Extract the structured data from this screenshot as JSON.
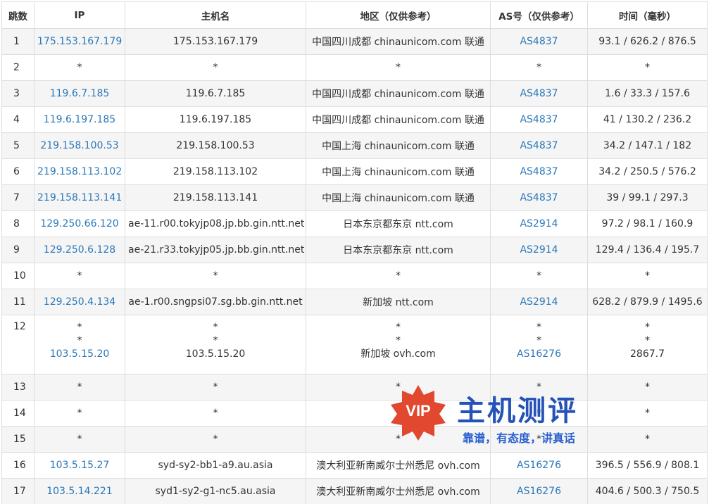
{
  "headers": [
    "跳数",
    "IP",
    "主机名",
    "地区（仅供参考）",
    "AS号（仅供参考）",
    "时间（毫秒）"
  ],
  "rows": [
    {
      "hop": "1",
      "ip": "175.153.167.179",
      "host": "175.153.167.179",
      "region": "中国四川成都 chinaunicom.com 联通",
      "as": "AS4837",
      "time": "93.1 / 626.2 / 876.5"
    },
    {
      "hop": "2",
      "ip": "*",
      "host": "*",
      "region": "*",
      "as": "*",
      "time": "*"
    },
    {
      "hop": "3",
      "ip": "119.6.7.185",
      "host": "119.6.7.185",
      "region": "中国四川成都 chinaunicom.com 联通",
      "as": "AS4837",
      "time": "1.6 / 33.3 / 157.6"
    },
    {
      "hop": "4",
      "ip": "119.6.197.185",
      "host": "119.6.197.185",
      "region": "中国四川成都 chinaunicom.com 联通",
      "as": "AS4837",
      "time": "41 / 130.2 / 236.2"
    },
    {
      "hop": "5",
      "ip": "219.158.100.53",
      "host": "219.158.100.53",
      "region": "中国上海 chinaunicom.com 联通",
      "as": "AS4837",
      "time": "34.2 / 147.1 / 182"
    },
    {
      "hop": "6",
      "ip": "219.158.113.102",
      "host": "219.158.113.102",
      "region": "中国上海 chinaunicom.com 联通",
      "as": "AS4837",
      "time": "34.2 / 250.5 / 576.2"
    },
    {
      "hop": "7",
      "ip": "219.158.113.141",
      "host": "219.158.113.141",
      "region": "中国上海 chinaunicom.com 联通",
      "as": "AS4837",
      "time": "39 / 99.1 / 297.3"
    },
    {
      "hop": "8",
      "ip": "129.250.66.120",
      "host": "ae-11.r00.tokyjp08.jp.bb.gin.ntt.net",
      "region": "日本东京都东京 ntt.com",
      "as": "AS2914",
      "time": "97.2 / 98.1 / 160.9"
    },
    {
      "hop": "9",
      "ip": "129.250.6.128",
      "host": "ae-21.r33.tokyjp05.jp.bb.gin.ntt.net",
      "region": "日本东京都东京 ntt.com",
      "as": "AS2914",
      "time": "129.4 / 136.4 / 195.7"
    },
    {
      "hop": "10",
      "ip": "*",
      "host": "*",
      "region": "*",
      "as": "*",
      "time": "*"
    },
    {
      "hop": "11",
      "ip": "129.250.4.134",
      "host": "ae-1.r00.sngpsi07.sg.bb.gin.ntt.net",
      "region": "新加坡 ntt.com",
      "as": "AS2914",
      "time": "628.2 / 879.9 / 1495.6"
    },
    {
      "hop": "12",
      "multi": true,
      "ip": [
        "*",
        "*",
        "103.5.15.20"
      ],
      "host": [
        "*",
        "*",
        "103.5.15.20"
      ],
      "region": [
        "*",
        "*",
        "新加坡 ovh.com"
      ],
      "as": [
        "*",
        "*",
        "AS16276"
      ],
      "time": [
        "*",
        "*",
        "2867.7"
      ]
    },
    {
      "hop": "13",
      "ip": "*",
      "host": "*",
      "region": "*",
      "as": "*",
      "time": "*"
    },
    {
      "hop": "14",
      "ip": "*",
      "host": "*",
      "region": "*",
      "as": "*",
      "time": "*"
    },
    {
      "hop": "15",
      "ip": "*",
      "host": "*",
      "region": "*",
      "as": "*",
      "time": "*"
    },
    {
      "hop": "16",
      "ip": "103.5.15.27",
      "host": "syd-sy2-bb1-a9.au.asia",
      "region": "澳大利亚新南威尔士州悉尼 ovh.com",
      "as": "AS16276",
      "time": "396.5 / 556.9 / 808.1"
    },
    {
      "hop": "17",
      "ip": "103.5.14.221",
      "host": "syd1-sy2-g1-nc5.au.asia",
      "region": "澳大利亚新南威尔士州悉尼 ovh.com",
      "as": "AS16276",
      "time": "404.6 / 500.3 / 750.5"
    }
  ],
  "watermark": {
    "badge": "VIP",
    "title": "主机测评",
    "slogan": "靠谱，有态度，讲真话"
  },
  "colors": {
    "link": "#2a78b9",
    "badge": "#e2472f",
    "watermark_title": "#2552b8"
  }
}
